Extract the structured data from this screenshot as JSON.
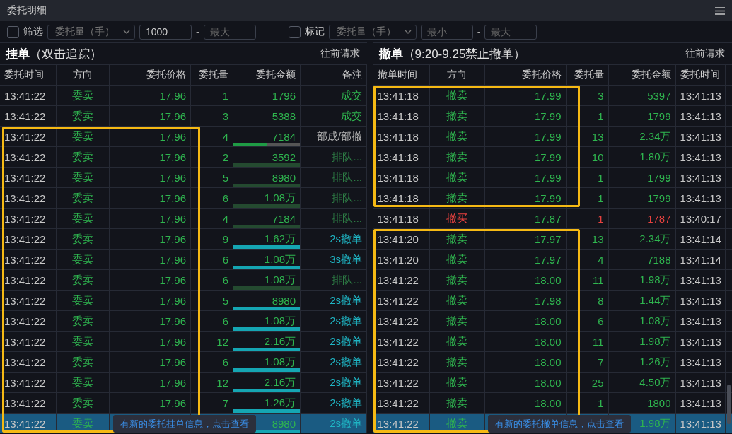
{
  "window": {
    "title": "委托明细"
  },
  "filter": [
    {
      "checked": false,
      "label": "筛选",
      "select": "委托量（手）",
      "min": {
        "value": "1000"
      },
      "separator": "-",
      "max": {
        "placeholder": "最大"
      }
    },
    {
      "checked": false,
      "label": "标记",
      "select": "委托量（手）",
      "min": {
        "placeholder": "最小"
      },
      "separator": "-",
      "max": {
        "placeholder": "最大"
      }
    }
  ],
  "panels": [
    {
      "kind": "orders",
      "title": "**挂单**（双击追踪）",
      "action": "往前请求",
      "columns": [
        "委托时间",
        "方向",
        "委托价格",
        "委托量",
        "委托金额",
        "备注"
      ],
      "toast": "有新的委托挂单信息，点击查看",
      "rows": [
        {
          "selected": false,
          "highlighted": false,
          "color": "#2fb54f",
          "kind": "filled",
          "cells": [
            "13:41:22",
            "委卖",
            "17.96",
            "1",
            "1796",
            "成交"
          ]
        },
        {
          "selected": false,
          "highlighted": false,
          "color": "#2fb54f",
          "kind": "filled",
          "cells": [
            "13:41:22",
            "委卖",
            "17.96",
            "3",
            "5388",
            "成交"
          ]
        },
        {
          "selected": false,
          "highlighted": true,
          "color": "#2fb54f",
          "kind": "partial",
          "level": 0.5,
          "cells": [
            "13:41:22",
            "委卖",
            "17.96",
            "4",
            "7184",
            "部成/部撤"
          ]
        },
        {
          "selected": false,
          "highlighted": true,
          "color": "#2fb54f",
          "kind": "queued",
          "cells": [
            "13:41:22",
            "委卖",
            "17.96",
            "2",
            "3592",
            "排队..."
          ]
        },
        {
          "selected": false,
          "highlighted": true,
          "color": "#2fb54f",
          "kind": "queued",
          "cells": [
            "13:41:22",
            "委卖",
            "17.96",
            "5",
            "8980",
            "排队..."
          ]
        },
        {
          "selected": false,
          "highlighted": true,
          "color": "#2fb54f",
          "kind": "queued",
          "cells": [
            "13:41:22",
            "委卖",
            "17.96",
            "6",
            "1.08万",
            "排队..."
          ]
        },
        {
          "selected": false,
          "highlighted": true,
          "color": "#2fb54f",
          "kind": "queued",
          "cells": [
            "13:41:22",
            "委卖",
            "17.96",
            "4",
            "7184",
            "排队..."
          ]
        },
        {
          "selected": false,
          "highlighted": true,
          "color": "#2fb54f",
          "kind": "cancel",
          "cells": [
            "13:41:22",
            "委卖",
            "17.96",
            "9",
            "1.62万",
            "2s撤单"
          ]
        },
        {
          "selected": false,
          "highlighted": true,
          "color": "#2fb54f",
          "kind": "cancel",
          "cells": [
            "13:41:22",
            "委卖",
            "17.96",
            "6",
            "1.08万",
            "3s撤单"
          ]
        },
        {
          "selected": false,
          "highlighted": true,
          "color": "#2fb54f",
          "kind": "queued",
          "cells": [
            "13:41:22",
            "委卖",
            "17.96",
            "6",
            "1.08万",
            "排队..."
          ]
        },
        {
          "selected": false,
          "highlighted": true,
          "color": "#2fb54f",
          "kind": "cancel",
          "cells": [
            "13:41:22",
            "委卖",
            "17.96",
            "5",
            "8980",
            "2s撤单"
          ]
        },
        {
          "selected": false,
          "highlighted": true,
          "color": "#2fb54f",
          "kind": "cancel",
          "cells": [
            "13:41:22",
            "委卖",
            "17.96",
            "6",
            "1.08万",
            "2s撤单"
          ]
        },
        {
          "selected": false,
          "highlighted": true,
          "color": "#2fb54f",
          "kind": "cancel",
          "cells": [
            "13:41:22",
            "委卖",
            "17.96",
            "12",
            "2.16万",
            "2s撤单"
          ]
        },
        {
          "selected": false,
          "highlighted": true,
          "color": "#2fb54f",
          "kind": "cancel",
          "cells": [
            "13:41:22",
            "委卖",
            "17.96",
            "6",
            "1.08万",
            "2s撤单"
          ]
        },
        {
          "selected": false,
          "highlighted": true,
          "color": "#2fb54f",
          "kind": "cancel",
          "cells": [
            "13:41:22",
            "委卖",
            "17.96",
            "12",
            "2.16万",
            "2s撤单"
          ]
        },
        {
          "selected": false,
          "highlighted": true,
          "color": "#2fb54f",
          "kind": "cancel",
          "cells": [
            "13:41:22",
            "委卖",
            "17.96",
            "7",
            "1.26万",
            "2s撤单"
          ]
        },
        {
          "selected": true,
          "highlighted": true,
          "color": "#2fb54f",
          "kind": "cancel",
          "cells": [
            "13:41:22",
            "委卖",
            "",
            "",
            "8980",
            "2s撤单"
          ]
        }
      ]
    },
    {
      "kind": "cancels",
      "title": "**撤单**（9:20-9.25禁止撤单）",
      "action": "往前请求",
      "columns": [
        "撤单时间",
        "方向",
        "委托价格",
        "委托量",
        "委托金额",
        "委托时间"
      ],
      "toast": "有新的委托撤单信息，点击查看",
      "rows": [
        {
          "selected": false,
          "highlighted": true,
          "color": "#2fb54f",
          "cells": [
            "13:41:18",
            "撤卖",
            "17.99",
            "3",
            "5397",
            "13:41:13"
          ]
        },
        {
          "selected": false,
          "highlighted": true,
          "color": "#2fb54f",
          "cells": [
            "13:41:18",
            "撤卖",
            "17.99",
            "1",
            "1799",
            "13:41:13"
          ]
        },
        {
          "selected": false,
          "highlighted": true,
          "color": "#2fb54f",
          "cells": [
            "13:41:18",
            "撤卖",
            "17.99",
            "13",
            "2.34万",
            "13:41:13"
          ]
        },
        {
          "selected": false,
          "highlighted": true,
          "color": "#2fb54f",
          "cells": [
            "13:41:18",
            "撤卖",
            "17.99",
            "10",
            "1.80万",
            "13:41:13"
          ]
        },
        {
          "selected": false,
          "highlighted": true,
          "color": "#2fb54f",
          "cells": [
            "13:41:18",
            "撤卖",
            "17.99",
            "1",
            "1799",
            "13:41:13"
          ]
        },
        {
          "selected": false,
          "highlighted": true,
          "color": "#2fb54f",
          "cells": [
            "13:41:18",
            "撤卖",
            "17.99",
            "1",
            "1799",
            "13:41:13"
          ]
        },
        {
          "selected": false,
          "highlighted": false,
          "color": "#e8423f",
          "cells": [
            "13:41:18",
            "撤买",
            "17.87",
            "1",
            "1787",
            "13:40:17"
          ]
        },
        {
          "selected": false,
          "highlighted": true,
          "color": "#2fb54f",
          "cells": [
            "13:41:20",
            "撤卖",
            "17.97",
            "13",
            "2.34万",
            "13:41:14"
          ]
        },
        {
          "selected": false,
          "highlighted": true,
          "color": "#2fb54f",
          "cells": [
            "13:41:20",
            "撤卖",
            "17.97",
            "4",
            "7188",
            "13:41:14"
          ]
        },
        {
          "selected": false,
          "highlighted": true,
          "color": "#2fb54f",
          "cells": [
            "13:41:22",
            "撤卖",
            "18.00",
            "11",
            "1.98万",
            "13:41:13"
          ]
        },
        {
          "selected": false,
          "highlighted": true,
          "color": "#2fb54f",
          "cells": [
            "13:41:22",
            "撤卖",
            "17.98",
            "8",
            "1.44万",
            "13:41:13"
          ]
        },
        {
          "selected": false,
          "highlighted": true,
          "color": "#2fb54f",
          "cells": [
            "13:41:22",
            "撤卖",
            "18.00",
            "6",
            "1.08万",
            "13:41:13"
          ]
        },
        {
          "selected": false,
          "highlighted": true,
          "color": "#2fb54f",
          "cells": [
            "13:41:22",
            "撤卖",
            "18.00",
            "11",
            "1.98万",
            "13:41:13"
          ]
        },
        {
          "selected": false,
          "highlighted": true,
          "color": "#2fb54f",
          "cells": [
            "13:41:22",
            "撤卖",
            "18.00",
            "7",
            "1.26万",
            "13:41:13"
          ]
        },
        {
          "selected": false,
          "highlighted": true,
          "color": "#2fb54f",
          "cells": [
            "13:41:22",
            "撤卖",
            "18.00",
            "25",
            "4.50万",
            "13:41:13"
          ]
        },
        {
          "selected": false,
          "highlighted": true,
          "color": "#2fb54f",
          "cells": [
            "13:41:22",
            "撤卖",
            "18.00",
            "1",
            "1800",
            "13:41:13"
          ]
        },
        {
          "selected": true,
          "highlighted": true,
          "color": "#2fb54f",
          "cells": [
            "13:41:22",
            "撤卖",
            "",
            "",
            "1.98万",
            "13:41:13"
          ]
        }
      ]
    }
  ]
}
